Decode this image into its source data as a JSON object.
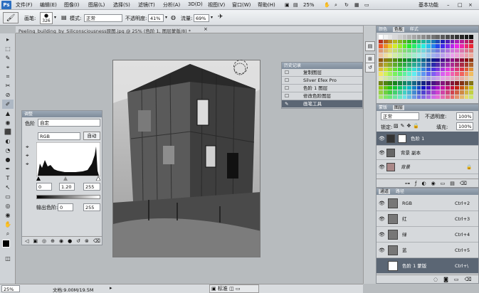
{
  "app": {
    "logo": "Ps",
    "menus": [
      "文件(F)",
      "编辑(E)",
      "图像(I)",
      "图层(L)",
      "选择(S)",
      "滤镜(T)",
      "分析(A)",
      "3D(D)",
      "视图(V)",
      "窗口(W)",
      "帮助(H)"
    ],
    "zoom": "25%",
    "workspace": "基本功能"
  },
  "options": {
    "brush_label": "画笔:",
    "brush_size": "326",
    "mode_label": "模式:",
    "mode_value": "正常",
    "opacity_label": "不透明度:",
    "opacity_value": "41%",
    "flow_label": "流量:",
    "flow_value": "69%"
  },
  "document": {
    "tab_label": "Peeling_building_by_Siliconsciousness原图.jpg @ 25% (色阶 1, 图层蒙版/8) *",
    "close": "×"
  },
  "tools": [
    "▸",
    "⬚",
    "✎",
    "⌖",
    "⌗",
    "✂",
    "⊘",
    "✐",
    "▲",
    "◉",
    "⬛",
    "◐",
    "T",
    "↖",
    "▭",
    "✋",
    "⌕"
  ],
  "history": {
    "title": "历史记录",
    "items": [
      "复制图层",
      "Silver Efex Pro",
      "色阶 1 图层",
      "修改色阶图层",
      "画笔工具"
    ]
  },
  "adjust": {
    "title": "调整",
    "preset_label": "色阶",
    "preset_value": "自定",
    "channel": "RGB",
    "auto": "自动",
    "in_black": "0",
    "in_gamma": "1.20",
    "in_white": "255",
    "out_label": "输出色阶:",
    "out_black": "0",
    "out_white": "255"
  },
  "swatches": {
    "tabs": [
      "颜色",
      "色板",
      "样式"
    ]
  },
  "layers": {
    "tabs": [
      "蒙版",
      "图层"
    ],
    "mode": "正常",
    "opacity_label": "不透明度:",
    "opacity": "100%",
    "lock_label": "锁定:",
    "fill_label": "填充:",
    "fill": "100%",
    "items": [
      "色阶 1",
      "背景 副本",
      "背景"
    ]
  },
  "channels": {
    "tabs": [
      "通道",
      "路径"
    ],
    "items": [
      {
        "name": "RGB",
        "key": "Ctrl+2"
      },
      {
        "name": "红",
        "key": "Ctrl+3"
      },
      {
        "name": "绿",
        "key": "Ctrl+4"
      },
      {
        "name": "蓝",
        "key": "Ctrl+5"
      },
      {
        "name": "色阶 1 蒙版",
        "key": "Ctrl+\\"
      }
    ]
  },
  "status": {
    "zoom": "25%",
    "doc": "文档:9.00M/19.5M",
    "mode_btn": "标准"
  }
}
